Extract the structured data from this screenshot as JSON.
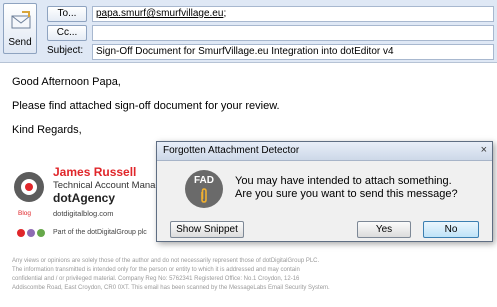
{
  "compose": {
    "send_label": "Send",
    "to_button": "To...",
    "cc_button": "Cc...",
    "subject_label": "Subject:",
    "to_value": "papa.smurf@smurfvillage.eu",
    "to_separator": ";",
    "cc_value": "",
    "subject_value": "Sign-Off Document for SmurfVillage.eu Integration into dotEditor v4"
  },
  "body": {
    "greeting": "Good Afternoon Papa,",
    "line1": "Please find attached sign-off document for your review.",
    "closing": "Kind Regards,"
  },
  "signature": {
    "name": "James Russell",
    "title": "Technical Account Manager",
    "company": "dotAgency",
    "blog_label": "Blog",
    "blog_url": "dotdigitalblog.com",
    "group": "Part of the dotDigitalGroup plc",
    "dot_colors": [
      "#e0262a",
      "#8e6bb3",
      "#66a84a"
    ],
    "accent": "#e0262a"
  },
  "disclaimer": [
    "Any views or opinions are solely those of the author and do not necessarily represent those of dotDigitalGroup PLC.",
    "The information transmitted is intended only for the person or entity to which it is addressed and may contain",
    "confidential and / or privileged material. Company Reg No: 5762341 Registered Office: No.1 Croydon, 12-16",
    "Addiscombe Road, East Croydon, CR0 0XT. This email has been scanned by the MessageLabs Email Security System."
  ],
  "dialog": {
    "title": "Forgotten Attachment Detector",
    "icon_text": "FAD",
    "message_line1": "You may have intended to attach something.",
    "message_line2": "Are you sure you want to send this message?",
    "show_snippet": "Show Snippet",
    "yes": "Yes",
    "no": "No",
    "close_symbol": "×"
  }
}
